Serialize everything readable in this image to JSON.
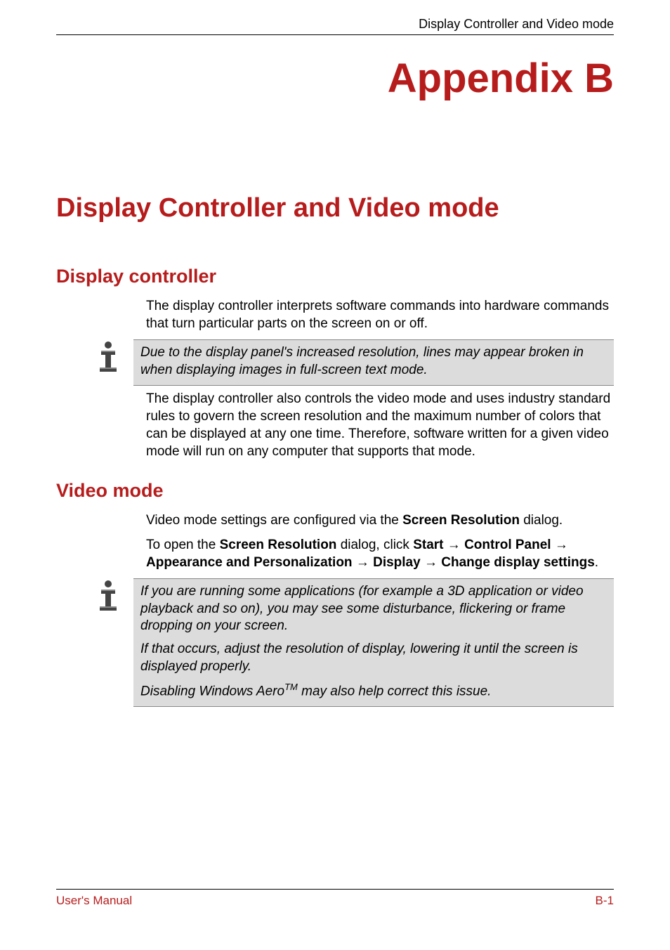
{
  "header": {
    "running_title": "Display Controller and Video mode"
  },
  "appendix": {
    "label": "Appendix B"
  },
  "chapter": {
    "title": "Display Controller and Video mode"
  },
  "s1": {
    "title": "Display controller",
    "p1": "The display controller interprets software commands into hardware commands that turn particular parts on the screen on or off.",
    "note1": "Due to the display panel's increased resolution, lines may appear broken in when displaying images in full-screen text mode.",
    "p2": "The display controller also controls the video mode and uses industry standard rules to govern the screen resolution and the maximum number of colors that can be displayed at any one time. Therefore, software written for a given video mode will run on any computer that supports that mode."
  },
  "s2": {
    "title": "Video mode",
    "p1_a": "Video mode settings are configured via the ",
    "p1_b": "Screen Resolution",
    "p1_c": " dialog.",
    "p2_a": "To open the ",
    "p2_b": "Screen Resolution",
    "p2_c": " dialog, click ",
    "nav1": "Start",
    "nav2": "Control Panel",
    "nav3": "Appearance and Personalization",
    "nav4": "Display",
    "nav5": "Change display settings",
    "arrow": "→",
    "period": ".",
    "note": {
      "p1": "If you are running some applications (for example a 3D application or video playback and so on), you may see some disturbance, flickering or frame dropping on your screen.",
      "p2": "If that occurs, adjust the resolution of display, lowering it until the screen is displayed properly.",
      "p3a": "Disabling Windows Aero",
      "p3tm": "TM",
      "p3b": " may also help correct this issue."
    }
  },
  "footer": {
    "left": "User's Manual",
    "right": "B-1"
  }
}
